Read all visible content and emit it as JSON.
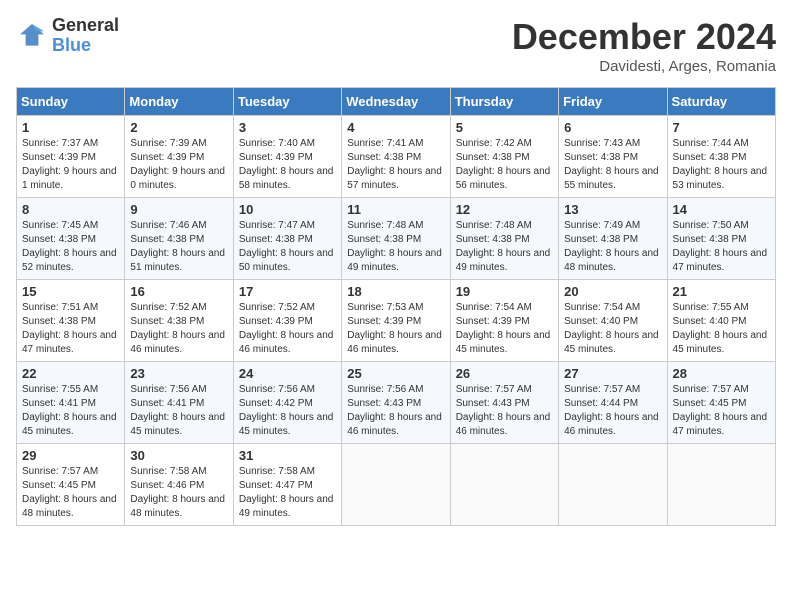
{
  "header": {
    "logo_line1": "General",
    "logo_line2": "Blue",
    "month_year": "December 2024",
    "location": "Davidesti, Arges, Romania"
  },
  "weekdays": [
    "Sunday",
    "Monday",
    "Tuesday",
    "Wednesday",
    "Thursday",
    "Friday",
    "Saturday"
  ],
  "weeks": [
    [
      {
        "day": "1",
        "sunrise": "7:37 AM",
        "sunset": "4:39 PM",
        "daylight": "9 hours and 1 minute."
      },
      {
        "day": "2",
        "sunrise": "7:39 AM",
        "sunset": "4:39 PM",
        "daylight": "9 hours and 0 minutes."
      },
      {
        "day": "3",
        "sunrise": "7:40 AM",
        "sunset": "4:39 PM",
        "daylight": "8 hours and 58 minutes."
      },
      {
        "day": "4",
        "sunrise": "7:41 AM",
        "sunset": "4:38 PM",
        "daylight": "8 hours and 57 minutes."
      },
      {
        "day": "5",
        "sunrise": "7:42 AM",
        "sunset": "4:38 PM",
        "daylight": "8 hours and 56 minutes."
      },
      {
        "day": "6",
        "sunrise": "7:43 AM",
        "sunset": "4:38 PM",
        "daylight": "8 hours and 55 minutes."
      },
      {
        "day": "7",
        "sunrise": "7:44 AM",
        "sunset": "4:38 PM",
        "daylight": "8 hours and 53 minutes."
      }
    ],
    [
      {
        "day": "8",
        "sunrise": "7:45 AM",
        "sunset": "4:38 PM",
        "daylight": "8 hours and 52 minutes."
      },
      {
        "day": "9",
        "sunrise": "7:46 AM",
        "sunset": "4:38 PM",
        "daylight": "8 hours and 51 minutes."
      },
      {
        "day": "10",
        "sunrise": "7:47 AM",
        "sunset": "4:38 PM",
        "daylight": "8 hours and 50 minutes."
      },
      {
        "day": "11",
        "sunrise": "7:48 AM",
        "sunset": "4:38 PM",
        "daylight": "8 hours and 49 minutes."
      },
      {
        "day": "12",
        "sunrise": "7:48 AM",
        "sunset": "4:38 PM",
        "daylight": "8 hours and 49 minutes."
      },
      {
        "day": "13",
        "sunrise": "7:49 AM",
        "sunset": "4:38 PM",
        "daylight": "8 hours and 48 minutes."
      },
      {
        "day": "14",
        "sunrise": "7:50 AM",
        "sunset": "4:38 PM",
        "daylight": "8 hours and 47 minutes."
      }
    ],
    [
      {
        "day": "15",
        "sunrise": "7:51 AM",
        "sunset": "4:38 PM",
        "daylight": "8 hours and 47 minutes."
      },
      {
        "day": "16",
        "sunrise": "7:52 AM",
        "sunset": "4:38 PM",
        "daylight": "8 hours and 46 minutes."
      },
      {
        "day": "17",
        "sunrise": "7:52 AM",
        "sunset": "4:39 PM",
        "daylight": "8 hours and 46 minutes."
      },
      {
        "day": "18",
        "sunrise": "7:53 AM",
        "sunset": "4:39 PM",
        "daylight": "8 hours and 46 minutes."
      },
      {
        "day": "19",
        "sunrise": "7:54 AM",
        "sunset": "4:39 PM",
        "daylight": "8 hours and 45 minutes."
      },
      {
        "day": "20",
        "sunrise": "7:54 AM",
        "sunset": "4:40 PM",
        "daylight": "8 hours and 45 minutes."
      },
      {
        "day": "21",
        "sunrise": "7:55 AM",
        "sunset": "4:40 PM",
        "daylight": "8 hours and 45 minutes."
      }
    ],
    [
      {
        "day": "22",
        "sunrise": "7:55 AM",
        "sunset": "4:41 PM",
        "daylight": "8 hours and 45 minutes."
      },
      {
        "day": "23",
        "sunrise": "7:56 AM",
        "sunset": "4:41 PM",
        "daylight": "8 hours and 45 minutes."
      },
      {
        "day": "24",
        "sunrise": "7:56 AM",
        "sunset": "4:42 PM",
        "daylight": "8 hours and 45 minutes."
      },
      {
        "day": "25",
        "sunrise": "7:56 AM",
        "sunset": "4:43 PM",
        "daylight": "8 hours and 46 minutes."
      },
      {
        "day": "26",
        "sunrise": "7:57 AM",
        "sunset": "4:43 PM",
        "daylight": "8 hours and 46 minutes."
      },
      {
        "day": "27",
        "sunrise": "7:57 AM",
        "sunset": "4:44 PM",
        "daylight": "8 hours and 46 minutes."
      },
      {
        "day": "28",
        "sunrise": "7:57 AM",
        "sunset": "4:45 PM",
        "daylight": "8 hours and 47 minutes."
      }
    ],
    [
      {
        "day": "29",
        "sunrise": "7:57 AM",
        "sunset": "4:45 PM",
        "daylight": "8 hours and 48 minutes."
      },
      {
        "day": "30",
        "sunrise": "7:58 AM",
        "sunset": "4:46 PM",
        "daylight": "8 hours and 48 minutes."
      },
      {
        "day": "31",
        "sunrise": "7:58 AM",
        "sunset": "4:47 PM",
        "daylight": "8 hours and 49 minutes."
      },
      null,
      null,
      null,
      null
    ]
  ],
  "labels": {
    "sunrise": "Sunrise:",
    "sunset": "Sunset:",
    "daylight": "Daylight:"
  }
}
